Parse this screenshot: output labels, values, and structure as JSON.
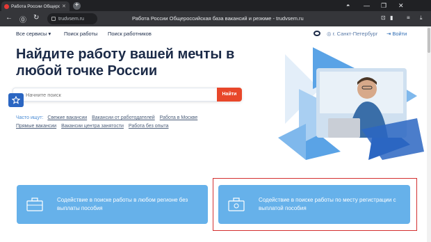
{
  "browser": {
    "tab_title": "Работа России Общероссийская база вакансий и резюме",
    "tab_close": "✕",
    "new_tab": "+",
    "url": "trudvsem.ru",
    "page_title": "Работа России Общероссийская база вакансий и резюме - trudvsem.ru"
  },
  "nav": {
    "all_services": "Все сервисы",
    "job_search": "Поиск работы",
    "worker_search": "Поиск работников",
    "region": "г. Санкт-Петербург",
    "login": "Войти"
  },
  "hero": {
    "title": "Найдите работу вашей мечты в любой точке России",
    "search_placeholder": "Начните поиск",
    "search_button": "Найти"
  },
  "often": {
    "label": "Часто ищут:",
    "links": [
      "Свежие вакансии",
      "Вакансии от работодателей",
      "Работа в Москве",
      "Прямые вакансии",
      "Вакансии центра занятости",
      "Работа без опыта"
    ]
  },
  "cards": [
    {
      "text": "Содействие в поиске работы в любом регионе без выплаты пособия"
    },
    {
      "text": "Содействие в поиске работы по месту регистрации с выплатой пособия"
    }
  ],
  "colors": {
    "accent": "#e8472a",
    "brand_blue": "#2b66c2",
    "card_blue": "#66b1ea",
    "highlight": "#d32f2f"
  }
}
